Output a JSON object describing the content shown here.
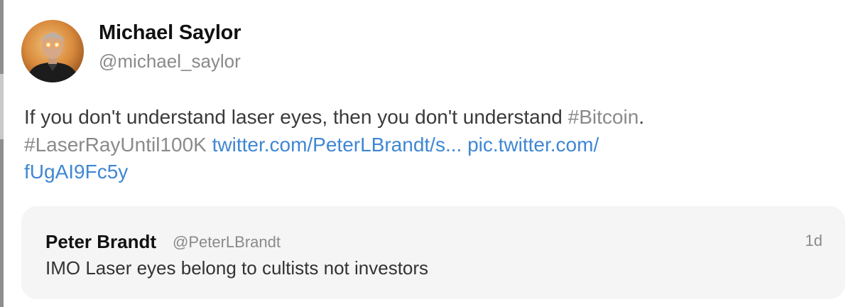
{
  "tweet": {
    "author": {
      "name": "Michael Saylor",
      "handle": "@michael_saylor",
      "avatar_icon": "profile-photo"
    },
    "body": {
      "text_1": "If you don't understand laser eyes, then you don't understand ",
      "hashtag_bitcoin": "#Bitcoin",
      "text_2": ".",
      "hashtag_laser": "#LaserRayUntil100K",
      "link_quoted": "twitter.com/PeterLBrandt/s...",
      "link_pic": "pic.twitter.com/\nfUgAI9Fc5y"
    },
    "quoted_tweet": {
      "name": "Peter Brandt",
      "handle": "@PeterLBrandt",
      "time": "1d",
      "text": "IMO Laser eyes belong to cultists not investors"
    }
  },
  "colors": {
    "name": "#111111",
    "handle": "#8a8a8a",
    "body_text": "#3a3a3a",
    "hashtag": "#8a8a8a",
    "link": "#3f87d2",
    "quote_background": "#f5f5f5",
    "laser_eyes": "#ff3b2f"
  }
}
